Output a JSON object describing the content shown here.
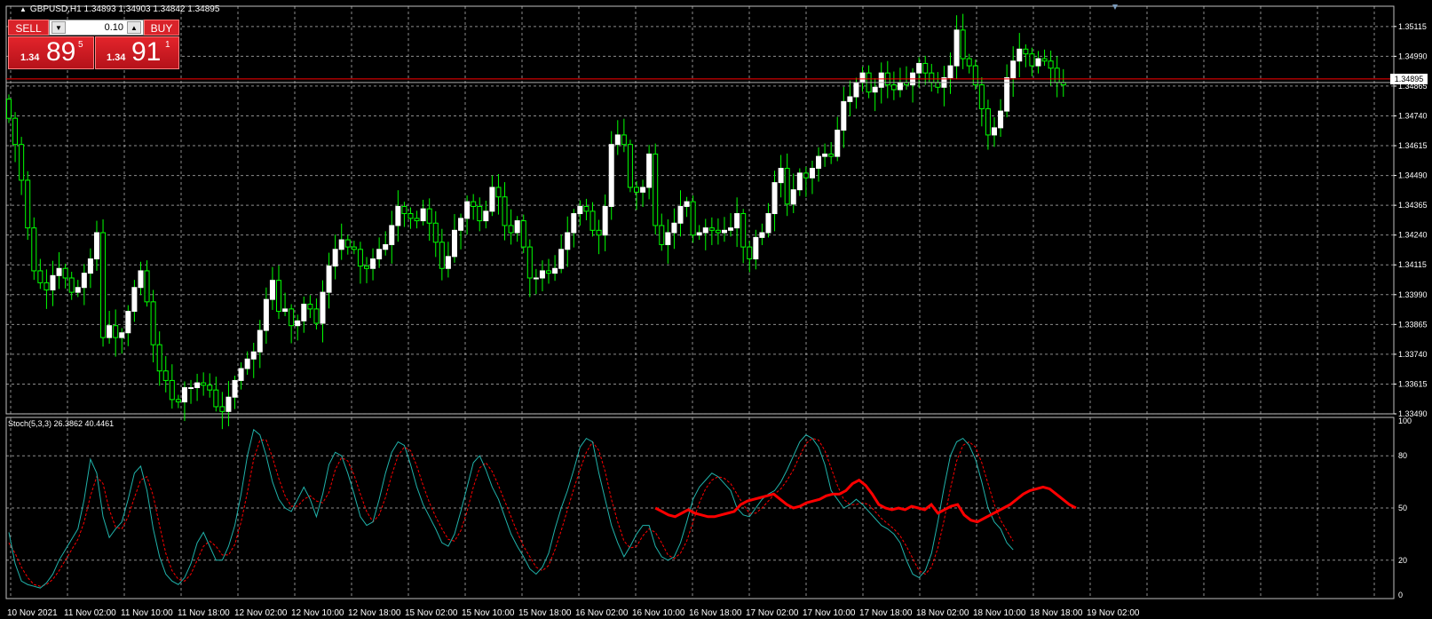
{
  "window": {
    "symbol_line": "GBPUSD,H1  1.34893 1.34903 1.34842 1.34895",
    "indicator_line": "Stoch(5,3,3) 26.3862 40.4461"
  },
  "trade_panel": {
    "sell_label": "SELL",
    "buy_label": "BUY",
    "lot_value": "0.10",
    "lot_down_icon": "arrow-down-icon",
    "lot_up_icon": "arrow-up-icon",
    "bid": {
      "small": "1.34",
      "big": "89",
      "sup": "5"
    },
    "ask": {
      "small": "1.34",
      "big": "91",
      "sup": "1"
    }
  },
  "current_price_tag": "1.34895",
  "colors": {
    "background": "#000000",
    "grid": "#c8c8c8",
    "bull_candle": "#ffffff",
    "wick": "#00ff00",
    "price_line": "#ff0000",
    "stoch_main": "#20b2aa",
    "stoch_signal": "#ff0000",
    "stoch_overlay": "#ff0000"
  },
  "chart_data": [
    {
      "type": "candlestick",
      "symbol": "GBPUSD",
      "timeframe": "H1",
      "ylim": [
        1.3349,
        1.352
      ],
      "y_ticks": [
        "1.35115",
        "1.34990",
        "1.34865",
        "1.34740",
        "1.34615",
        "1.34490",
        "1.34365",
        "1.34240",
        "1.34115",
        "1.33990",
        "1.33865",
        "1.33740",
        "1.33615",
        "1.33490"
      ],
      "x_ticks": [
        "10 Nov 2021",
        "11 Nov 02:00",
        "11 Nov 10:00",
        "11 Nov 18:00",
        "12 Nov 02:00",
        "12 Nov 10:00",
        "12 Nov 18:00",
        "15 Nov 02:00",
        "15 Nov 10:00",
        "15 Nov 18:00",
        "16 Nov 02:00",
        "16 Nov 10:00",
        "16 Nov 18:00",
        "17 Nov 02:00",
        "17 Nov 10:00",
        "17 Nov 18:00",
        "18 Nov 02:00",
        "18 Nov 10:00",
        "18 Nov 18:00",
        "19 Nov 02:00"
      ],
      "current_price": 1.34895,
      "close": [
        1.3473,
        1.3462,
        1.3447,
        1.3427,
        1.3409,
        1.3404,
        1.3401,
        1.3407,
        1.341,
        1.3406,
        1.34,
        1.3402,
        1.3408,
        1.3414,
        1.3425,
        1.3381,
        1.3386,
        1.3381,
        1.3383,
        1.3392,
        1.3402,
        1.3409,
        1.3396,
        1.3378,
        1.3367,
        1.3363,
        1.3355,
        1.3354,
        1.336,
        1.336,
        1.3362,
        1.3361,
        1.3359,
        1.3352,
        1.335,
        1.3356,
        1.3363,
        1.3368,
        1.3372,
        1.3375,
        1.3384,
        1.3397,
        1.3405,
        1.3392,
        1.3393,
        1.3386,
        1.3388,
        1.3395,
        1.3393,
        1.3387,
        1.34,
        1.3411,
        1.3418,
        1.3422,
        1.3419,
        1.3418,
        1.3411,
        1.341,
        1.3414,
        1.3418,
        1.342,
        1.3428,
        1.3436,
        1.3433,
        1.3431,
        1.343,
        1.3435,
        1.3429,
        1.3421,
        1.341,
        1.3415,
        1.3426,
        1.3431,
        1.3438,
        1.3436,
        1.343,
        1.3434,
        1.3444,
        1.344,
        1.3428,
        1.3425,
        1.343,
        1.3419,
        1.3406,
        1.3406,
        1.3409,
        1.3408,
        1.341,
        1.3418,
        1.3425,
        1.3433,
        1.3436,
        1.3434,
        1.3426,
        1.3424,
        1.3436,
        1.3462,
        1.3466,
        1.3462,
        1.3444,
        1.3442,
        1.3444,
        1.3458,
        1.3428,
        1.342,
        1.3425,
        1.3429,
        1.3436,
        1.3438,
        1.3424,
        1.3425,
        1.3427,
        1.3426,
        1.3425,
        1.3426,
        1.3427,
        1.3433,
        1.3419,
        1.3414,
        1.3423,
        1.3425,
        1.3433,
        1.3446,
        1.3452,
        1.3437,
        1.3443,
        1.345,
        1.3448,
        1.3452,
        1.3457,
        1.3458,
        1.3457,
        1.3468,
        1.348,
        1.3482,
        1.3488,
        1.3492,
        1.3484,
        1.3486,
        1.3492,
        1.3487,
        1.3485,
        1.3488,
        1.3487,
        1.3492,
        1.3496,
        1.3492,
        1.3488,
        1.3486,
        1.349,
        1.3495,
        1.351,
        1.3498,
        1.3495,
        1.3487,
        1.3477,
        1.3466,
        1.3469,
        1.3476,
        1.349,
        1.3497,
        1.3502,
        1.35,
        1.3495,
        1.3498,
        1.3497,
        1.3494,
        1.3488,
        1.3487
      ]
    },
    {
      "type": "line",
      "title": "Stoch(5,3,3) 26.3862 40.4461",
      "ylim": [
        0,
        100
      ],
      "y_ticks": [
        "100",
        "80",
        "50",
        "20",
        "0"
      ],
      "levels": [
        20,
        50,
        80
      ],
      "series": [
        {
          "name": "Main",
          "values": [
            36,
            18,
            8,
            6,
            5,
            4,
            7,
            12,
            20,
            26,
            32,
            38,
            55,
            78,
            70,
            45,
            33,
            38,
            42,
            55,
            70,
            74,
            60,
            38,
            22,
            12,
            8,
            6,
            10,
            18,
            30,
            36,
            28,
            20,
            20,
            28,
            40,
            58,
            80,
            95,
            92,
            80,
            65,
            55,
            50,
            48,
            55,
            62,
            55,
            45,
            58,
            75,
            82,
            80,
            70,
            58,
            45,
            40,
            42,
            55,
            70,
            82,
            88,
            86,
            75,
            62,
            52,
            45,
            38,
            30,
            28,
            35,
            48,
            62,
            76,
            80,
            72,
            62,
            55,
            45,
            35,
            28,
            22,
            15,
            12,
            16,
            24,
            38,
            50,
            60,
            72,
            85,
            90,
            88,
            70,
            55,
            40,
            30,
            22,
            28,
            35,
            40,
            40,
            28,
            22,
            20,
            22,
            30,
            42,
            55,
            62,
            66,
            70,
            68,
            64,
            60,
            50,
            46,
            45,
            50,
            55,
            58,
            60,
            65,
            72,
            80,
            88,
            92,
            90,
            85,
            75,
            60,
            55,
            50,
            52,
            55,
            52,
            48,
            44,
            40,
            38,
            35,
            30,
            20,
            12,
            10,
            14,
            24,
            42,
            62,
            80,
            88,
            90,
            86,
            78,
            65,
            50,
            42,
            38,
            30,
            26
          ]
        },
        {
          "name": "Signal",
          "values": [
            30,
            24,
            16,
            10,
            6,
            5,
            6,
            9,
            14,
            20,
            26,
            32,
            42,
            57,
            68,
            64,
            49,
            39,
            38,
            45,
            56,
            66,
            68,
            57,
            40,
            24,
            14,
            9,
            8,
            12,
            20,
            28,
            31,
            28,
            23,
            23,
            29,
            42,
            59,
            78,
            89,
            89,
            79,
            67,
            57,
            51,
            51,
            55,
            57,
            54,
            53,
            59,
            72,
            79,
            77,
            69,
            58,
            48,
            42,
            46,
            56,
            69,
            80,
            85,
            83,
            74,
            63,
            53,
            45,
            38,
            32,
            31,
            37,
            48,
            62,
            73,
            76,
            71,
            63,
            54,
            45,
            36,
            28,
            22,
            16,
            14,
            17,
            26,
            37,
            49,
            61,
            72,
            82,
            88,
            83,
            71,
            55,
            42,
            31,
            27,
            28,
            34,
            38,
            36,
            30,
            23,
            21,
            24,
            31,
            42,
            53,
            61,
            66,
            68,
            67,
            64,
            58,
            52,
            47,
            47,
            50,
            54,
            58,
            61,
            66,
            72,
            80,
            87,
            90,
            89,
            83,
            73,
            63,
            55,
            52,
            52,
            53,
            52,
            48,
            44,
            41,
            38,
            34,
            28,
            21,
            14,
            12,
            16,
            27,
            43,
            61,
            77,
            86,
            88,
            85,
            76,
            64,
            52,
            43,
            37,
            31
          ]
        },
        {
          "name": "Overlay",
          "values": [
            50,
            48,
            46,
            45,
            47,
            49,
            47,
            46,
            45,
            45,
            46,
            47,
            48,
            52,
            54,
            55,
            56,
            57,
            58,
            55,
            52,
            50,
            51,
            53,
            54,
            55,
            57,
            58,
            58,
            60,
            64,
            66,
            63,
            58,
            52,
            50,
            49,
            50,
            49,
            51,
            50,
            49,
            52,
            47,
            49,
            51,
            52,
            46,
            43,
            42,
            44,
            46,
            48,
            50,
            52,
            55,
            58,
            60,
            61,
            62,
            61,
            58,
            55,
            52,
            50
          ]
        }
      ]
    }
  ]
}
